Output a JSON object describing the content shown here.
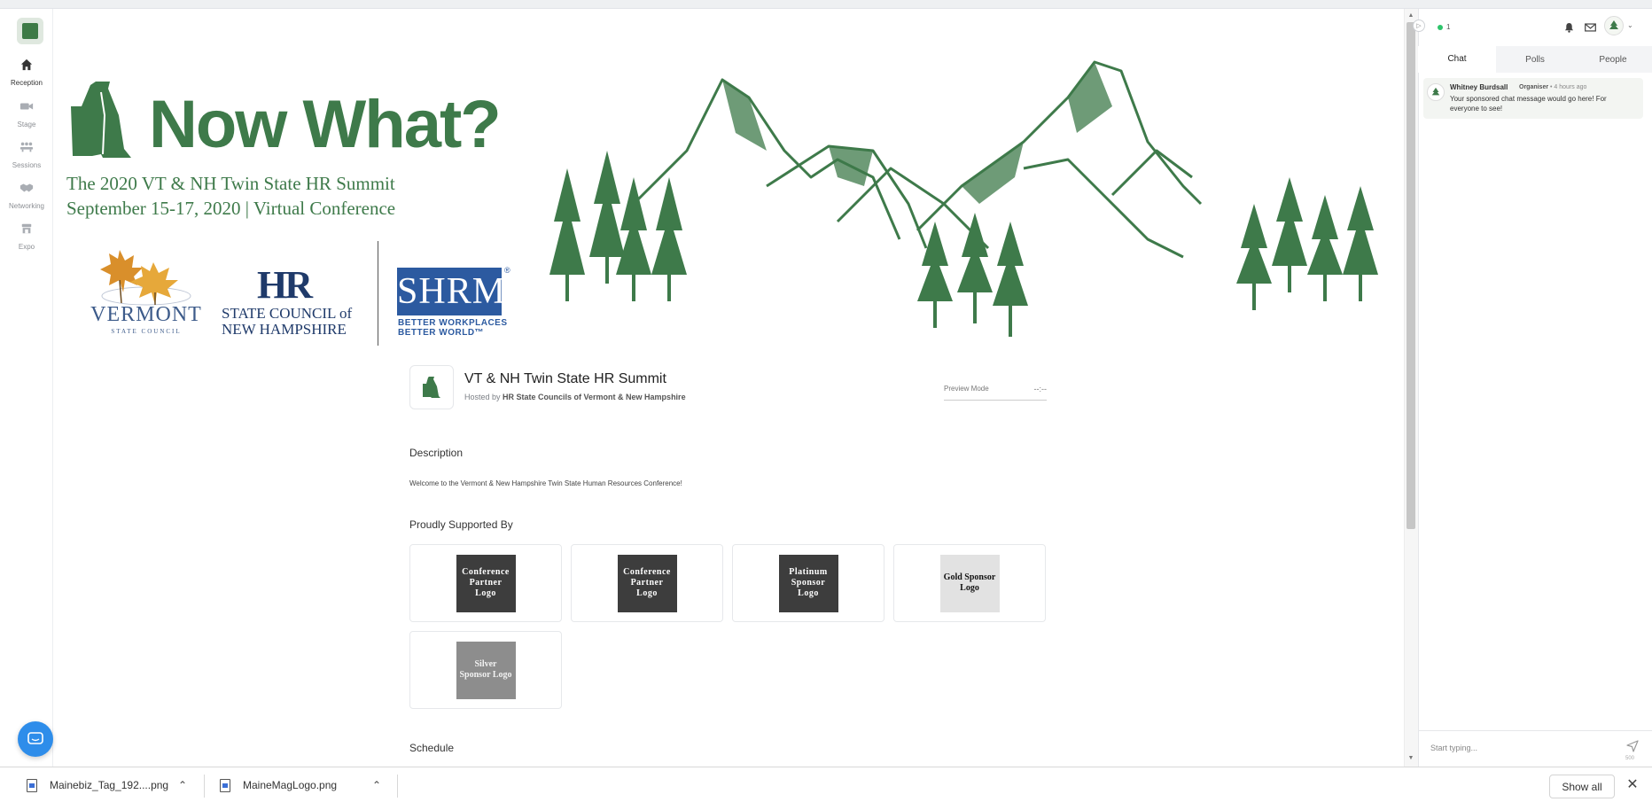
{
  "nav": {
    "items": [
      {
        "label": "Reception",
        "icon": "home-icon"
      },
      {
        "label": "Stage",
        "icon": "video-camera-icon"
      },
      {
        "label": "Sessions",
        "icon": "people-table-icon"
      },
      {
        "label": "Networking",
        "icon": "handshake-icon"
      },
      {
        "label": "Expo",
        "icon": "booth-icon"
      }
    ]
  },
  "banner": {
    "title": "Now What?",
    "subtitle_line1": "The 2020 VT & NH Twin State HR Summit",
    "subtitle_line2": "September 15-17, 2020 | Virtual Conference",
    "vermont_word": "VERMONT",
    "vermont_small": "STATE COUNCIL",
    "hr_big": "HR",
    "hr_line1": "STATE COUNCIL of",
    "hr_line2": "NEW HAMPSHIRE",
    "shrm": "SHRM",
    "shrm_reg": "®",
    "shrm_tag1": "BETTER WORKPLACES",
    "shrm_tag2": "BETTER WORLD™"
  },
  "event": {
    "title": "VT & NH Twin State HR Summit",
    "hosted_prefix": "Hosted by ",
    "host": "HR State Councils of Vermont & New Hampshire",
    "preview_label": "Preview Mode",
    "preview_value": "--:--"
  },
  "description": {
    "heading": "Description",
    "text": "Welcome to the Vermont & New Hampshire Twin State Human Resources Conference!"
  },
  "sponsors": {
    "heading": "Proudly Supported By",
    "items": [
      {
        "label": "Conference Partner Logo"
      },
      {
        "label": "Conference Partner Logo"
      },
      {
        "label": "Platinum Sponsor Logo"
      },
      {
        "label": "Gold Sponsor Logo"
      },
      {
        "label": "Silver Sponsor Logo"
      }
    ]
  },
  "schedule": {
    "heading": "Schedule"
  },
  "chat": {
    "online_count": "1",
    "tabs": [
      "Chat",
      "Polls",
      "People"
    ],
    "message": {
      "author": "Whitney Burdsall",
      "role": "Organiser",
      "time": "• 4 hours ago",
      "text": "Your sponsored chat message would go here! For everyone to see!"
    },
    "input_placeholder": "Start typing...",
    "char_count": "500"
  },
  "downloads": {
    "items": [
      {
        "name": "Mainebiz_Tag_192....png"
      },
      {
        "name": "MaineMagLogo.png"
      }
    ],
    "show_all": "Show all"
  },
  "colors": {
    "brand_green": "#3e7a4a",
    "intercom_blue": "#2e8dea",
    "shrm_blue": "#2c5aa0",
    "online_green": "#2ec46b"
  }
}
